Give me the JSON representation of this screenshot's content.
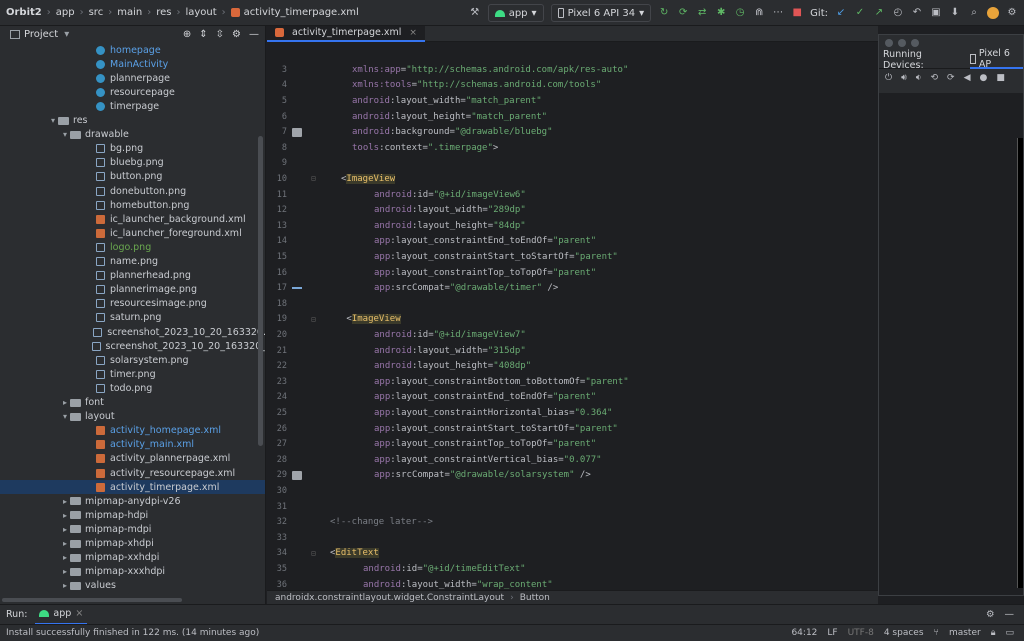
{
  "toolbar": {
    "breadcrumbs": [
      "Orbit2",
      "app",
      "src",
      "main",
      "res",
      "layout",
      "activity_timerpage.xml"
    ],
    "run_config": "app",
    "device": "Pixel 6 API 34",
    "git_label": "Git:"
  },
  "project_panel": {
    "title": "Project",
    "rows": [
      {
        "label": "homepage",
        "indent": 96,
        "icon": "c",
        "color": "blue",
        "arrow": ""
      },
      {
        "label": "MainActivity",
        "indent": 96,
        "icon": "c",
        "color": "blue",
        "arrow": ""
      },
      {
        "label": "plannerpage",
        "indent": 96,
        "icon": "c",
        "color": "",
        "arrow": ""
      },
      {
        "label": "resourcepage",
        "indent": 96,
        "icon": "c",
        "color": "",
        "arrow": ""
      },
      {
        "label": "timerpage",
        "indent": 96,
        "icon": "c",
        "color": "",
        "arrow": ""
      },
      {
        "label": "res",
        "indent": 58,
        "icon": "folder",
        "color": "",
        "arrow": "▾"
      },
      {
        "label": "drawable",
        "indent": 70,
        "icon": "folder",
        "color": "",
        "arrow": "▾"
      },
      {
        "label": "bg.png",
        "indent": 96,
        "icon": "img",
        "color": "",
        "arrow": ""
      },
      {
        "label": "bluebg.png",
        "indent": 96,
        "icon": "img",
        "color": "",
        "arrow": ""
      },
      {
        "label": "button.png",
        "indent": 96,
        "icon": "img",
        "color": "",
        "arrow": ""
      },
      {
        "label": "donebutton.png",
        "indent": 96,
        "icon": "img",
        "color": "",
        "arrow": ""
      },
      {
        "label": "homebutton.png",
        "indent": 96,
        "icon": "img",
        "color": "",
        "arrow": ""
      },
      {
        "label": "ic_launcher_background.xml",
        "indent": 96,
        "icon": "xml",
        "color": "",
        "arrow": ""
      },
      {
        "label": "ic_launcher_foreground.xml",
        "indent": 96,
        "icon": "xml",
        "color": "",
        "arrow": ""
      },
      {
        "label": "logo.png",
        "indent": 96,
        "icon": "img",
        "color": "green",
        "arrow": ""
      },
      {
        "label": "name.png",
        "indent": 96,
        "icon": "img",
        "color": "",
        "arrow": ""
      },
      {
        "label": "plannerhead.png",
        "indent": 96,
        "icon": "img",
        "color": "",
        "arrow": ""
      },
      {
        "label": "plannerimage.png",
        "indent": 96,
        "icon": "img",
        "color": "",
        "arrow": ""
      },
      {
        "label": "resourcesimage.png",
        "indent": 96,
        "icon": "img",
        "color": "",
        "arrow": ""
      },
      {
        "label": "saturn.png",
        "indent": 96,
        "icon": "img",
        "color": "",
        "arrow": ""
      },
      {
        "label": "screenshot_2023_10_20_163320.",
        "indent": 96,
        "icon": "img",
        "color": "",
        "arrow": ""
      },
      {
        "label": "screenshot_2023_10_20_163320_",
        "indent": 96,
        "icon": "img",
        "color": "",
        "arrow": ""
      },
      {
        "label": "solarsystem.png",
        "indent": 96,
        "icon": "img",
        "color": "",
        "arrow": ""
      },
      {
        "label": "timer.png",
        "indent": 96,
        "icon": "img",
        "color": "",
        "arrow": ""
      },
      {
        "label": "todo.png",
        "indent": 96,
        "icon": "img",
        "color": "",
        "arrow": ""
      },
      {
        "label": "font",
        "indent": 70,
        "icon": "folder",
        "color": "",
        "arrow": "▸"
      },
      {
        "label": "layout",
        "indent": 70,
        "icon": "folder",
        "color": "",
        "arrow": "▾"
      },
      {
        "label": "activity_homepage.xml",
        "indent": 96,
        "icon": "xml",
        "color": "blue",
        "arrow": ""
      },
      {
        "label": "activity_main.xml",
        "indent": 96,
        "icon": "xml",
        "color": "blue",
        "arrow": ""
      },
      {
        "label": "activity_plannerpage.xml",
        "indent": 96,
        "icon": "xml",
        "color": "",
        "arrow": ""
      },
      {
        "label": "activity_resourcepage.xml",
        "indent": 96,
        "icon": "xml",
        "color": "",
        "arrow": ""
      },
      {
        "label": "activity_timerpage.xml",
        "indent": 96,
        "icon": "xml",
        "color": "",
        "arrow": "",
        "selected": true
      },
      {
        "label": "mipmap-anydpi-v26",
        "indent": 70,
        "icon": "folder",
        "color": "",
        "arrow": "▸"
      },
      {
        "label": "mipmap-hdpi",
        "indent": 70,
        "icon": "folder",
        "color": "",
        "arrow": "▸"
      },
      {
        "label": "mipmap-mdpi",
        "indent": 70,
        "icon": "folder",
        "color": "",
        "arrow": "▸"
      },
      {
        "label": "mipmap-xhdpi",
        "indent": 70,
        "icon": "folder",
        "color": "",
        "arrow": "▸"
      },
      {
        "label": "mipmap-xxhdpi",
        "indent": 70,
        "icon": "folder",
        "color": "",
        "arrow": "▸"
      },
      {
        "label": "mipmap-xxxhdpi",
        "indent": 70,
        "icon": "folder",
        "color": "",
        "arrow": "▸"
      },
      {
        "label": "values",
        "indent": 70,
        "icon": "folder",
        "color": "",
        "arrow": "▸"
      }
    ]
  },
  "editor": {
    "tab_label": "activity_timerpage.xml",
    "lines": [
      {
        "n": "3",
        "indent": 3,
        "parts": [
          [
            "ns",
            "xmlns:"
          ],
          [
            "ns",
            "app"
          ],
          [
            "punc",
            "="
          ],
          [
            "val",
            "\"http://schemas.android.com/apk/res-auto\""
          ]
        ]
      },
      {
        "n": "4",
        "indent": 3,
        "parts": [
          [
            "ns",
            "xmlns:"
          ],
          [
            "ns",
            "tools"
          ],
          [
            "punc",
            "="
          ],
          [
            "val",
            "\"http://schemas.android.com/tools\""
          ]
        ]
      },
      {
        "n": "5",
        "indent": 3,
        "parts": [
          [
            "ns",
            "android"
          ],
          [
            "attr",
            ":layout_width"
          ],
          [
            "punc",
            "="
          ],
          [
            "val",
            "\"match_parent\""
          ]
        ]
      },
      {
        "n": "6",
        "indent": 3,
        "parts": [
          [
            "ns",
            "android"
          ],
          [
            "attr",
            ":layout_height"
          ],
          [
            "punc",
            "="
          ],
          [
            "val",
            "\"match_parent\""
          ]
        ]
      },
      {
        "n": "7",
        "indent": 3,
        "gutter": "img",
        "parts": [
          [
            "ns",
            "android"
          ],
          [
            "attr",
            ":background"
          ],
          [
            "punc",
            "="
          ],
          [
            "val",
            "\"@drawable/bluebg\""
          ]
        ]
      },
      {
        "n": "8",
        "indent": 3,
        "parts": [
          [
            "ns",
            "tools"
          ],
          [
            "attr",
            ":context"
          ],
          [
            "punc",
            "="
          ],
          [
            "val",
            "\".timerpage\""
          ],
          [
            "punc",
            ">"
          ]
        ]
      },
      {
        "n": "9",
        "indent": 0,
        "parts": []
      },
      {
        "n": "10",
        "indent": 2,
        "fold": true,
        "parts": [
          [
            "punc",
            "<"
          ],
          [
            "tag",
            "ImageView"
          ]
        ]
      },
      {
        "n": "11",
        "indent": 5,
        "parts": [
          [
            "ns",
            "android"
          ],
          [
            "attr",
            ":id"
          ],
          [
            "punc",
            "="
          ],
          [
            "val",
            "\"@+id/imageView6\""
          ]
        ]
      },
      {
        "n": "12",
        "indent": 5,
        "parts": [
          [
            "ns",
            "android"
          ],
          [
            "attr",
            ":layout_width"
          ],
          [
            "punc",
            "="
          ],
          [
            "val",
            "\"289dp\""
          ]
        ]
      },
      {
        "n": "13",
        "indent": 5,
        "parts": [
          [
            "ns",
            "android"
          ],
          [
            "attr",
            ":layout_height"
          ],
          [
            "punc",
            "="
          ],
          [
            "val",
            "\"84dp\""
          ]
        ]
      },
      {
        "n": "14",
        "indent": 5,
        "parts": [
          [
            "ns",
            "app"
          ],
          [
            "attr",
            ":layout_constraintEnd_toEndOf"
          ],
          [
            "punc",
            "="
          ],
          [
            "val",
            "\"parent\""
          ]
        ]
      },
      {
        "n": "15",
        "indent": 5,
        "parts": [
          [
            "ns",
            "app"
          ],
          [
            "attr",
            ":layout_constraintStart_toStartOf"
          ],
          [
            "punc",
            "="
          ],
          [
            "val",
            "\"parent\""
          ]
        ]
      },
      {
        "n": "16",
        "indent": 5,
        "parts": [
          [
            "ns",
            "app"
          ],
          [
            "attr",
            ":layout_constraintTop_toTopOf"
          ],
          [
            "punc",
            "="
          ],
          [
            "val",
            "\"parent\""
          ]
        ]
      },
      {
        "n": "17",
        "indent": 5,
        "gutter": "bar",
        "parts": [
          [
            "ns",
            "app"
          ],
          [
            "attr",
            ":srcCompat"
          ],
          [
            "punc",
            "="
          ],
          [
            "val",
            "\"@drawable/timer\""
          ],
          [
            "punc",
            " />"
          ]
        ]
      },
      {
        "n": "18",
        "indent": 0,
        "parts": []
      },
      {
        "n": "19",
        "indent": 2,
        "fold": true,
        "parts": [
          [
            "punc",
            " <"
          ],
          [
            "tag",
            "ImageView"
          ]
        ]
      },
      {
        "n": "20",
        "indent": 5,
        "parts": [
          [
            "ns",
            "android"
          ],
          [
            "attr",
            ":id"
          ],
          [
            "punc",
            "="
          ],
          [
            "val",
            "\"@+id/imageView7\""
          ]
        ]
      },
      {
        "n": "21",
        "indent": 5,
        "parts": [
          [
            "ns",
            "android"
          ],
          [
            "attr",
            ":layout_width"
          ],
          [
            "punc",
            "="
          ],
          [
            "val",
            "\"315dp\""
          ]
        ]
      },
      {
        "n": "22",
        "indent": 5,
        "parts": [
          [
            "ns",
            "android"
          ],
          [
            "attr",
            ":layout_height"
          ],
          [
            "punc",
            "="
          ],
          [
            "val",
            "\"408dp\""
          ]
        ]
      },
      {
        "n": "23",
        "indent": 5,
        "parts": [
          [
            "ns",
            "app"
          ],
          [
            "attr",
            ":layout_constraintBottom_toBottomOf"
          ],
          [
            "punc",
            "="
          ],
          [
            "val",
            "\"parent\""
          ]
        ]
      },
      {
        "n": "24",
        "indent": 5,
        "parts": [
          [
            "ns",
            "app"
          ],
          [
            "attr",
            ":layout_constraintEnd_toEndOf"
          ],
          [
            "punc",
            "="
          ],
          [
            "val",
            "\"parent\""
          ]
        ]
      },
      {
        "n": "25",
        "indent": 5,
        "parts": [
          [
            "ns",
            "app"
          ],
          [
            "attr",
            ":layout_constraintHorizontal_bias"
          ],
          [
            "punc",
            "="
          ],
          [
            "val",
            "\"0.364\""
          ]
        ]
      },
      {
        "n": "26",
        "indent": 5,
        "parts": [
          [
            "ns",
            "app"
          ],
          [
            "attr",
            ":layout_constraintStart_toStartOf"
          ],
          [
            "punc",
            "="
          ],
          [
            "val",
            "\"parent\""
          ]
        ]
      },
      {
        "n": "27",
        "indent": 5,
        "parts": [
          [
            "ns",
            "app"
          ],
          [
            "attr",
            ":layout_constraintTop_toTopOf"
          ],
          [
            "punc",
            "="
          ],
          [
            "val",
            "\"parent\""
          ]
        ]
      },
      {
        "n": "28",
        "indent": 5,
        "parts": [
          [
            "ns",
            "app"
          ],
          [
            "attr",
            ":layout_constraintVertical_bias"
          ],
          [
            "punc",
            "="
          ],
          [
            "val",
            "\"0.077\""
          ]
        ]
      },
      {
        "n": "29",
        "indent": 5,
        "gutter": "img",
        "parts": [
          [
            "ns",
            "app"
          ],
          [
            "attr",
            ":srcCompat"
          ],
          [
            "punc",
            "="
          ],
          [
            "val",
            "\"@drawable/solarsystem\""
          ],
          [
            "punc",
            " />"
          ]
        ]
      },
      {
        "n": "30",
        "indent": 0,
        "parts": []
      },
      {
        "n": "31",
        "indent": 0,
        "parts": []
      },
      {
        "n": "32",
        "indent": 1,
        "parts": [
          [
            "cmt",
            "<!--change later-->"
          ]
        ]
      },
      {
        "n": "33",
        "indent": 0,
        "parts": []
      },
      {
        "n": "34",
        "indent": 1,
        "fold": true,
        "parts": [
          [
            "punc",
            "<"
          ],
          [
            "tag",
            "EditText"
          ]
        ]
      },
      {
        "n": "35",
        "indent": 4,
        "parts": [
          [
            "ns",
            "android"
          ],
          [
            "attr",
            ":id"
          ],
          [
            "punc",
            "="
          ],
          [
            "val",
            "\"@+id/timeEditText\""
          ]
        ]
      },
      {
        "n": "36",
        "indent": 4,
        "parts": [
          [
            "ns",
            "android"
          ],
          [
            "attr",
            ":layout_width"
          ],
          [
            "punc",
            "="
          ],
          [
            "val",
            "\"wrap_content\""
          ]
        ]
      }
    ],
    "breadcrumb": [
      "androidx.constraintlayout.widget.ConstraintLayout",
      "Button"
    ]
  },
  "devices": {
    "title": "Running Devices:",
    "tab": "Pixel 6 AP"
  },
  "runbar": {
    "label": "Run:",
    "app": "app"
  },
  "status": {
    "message": "Install successfully finished in 122 ms. (14 minutes ago)",
    "position": "64:12",
    "line_sep": "LF",
    "encoding": "UTF-8",
    "indent": "4 spaces",
    "branch": "master"
  }
}
